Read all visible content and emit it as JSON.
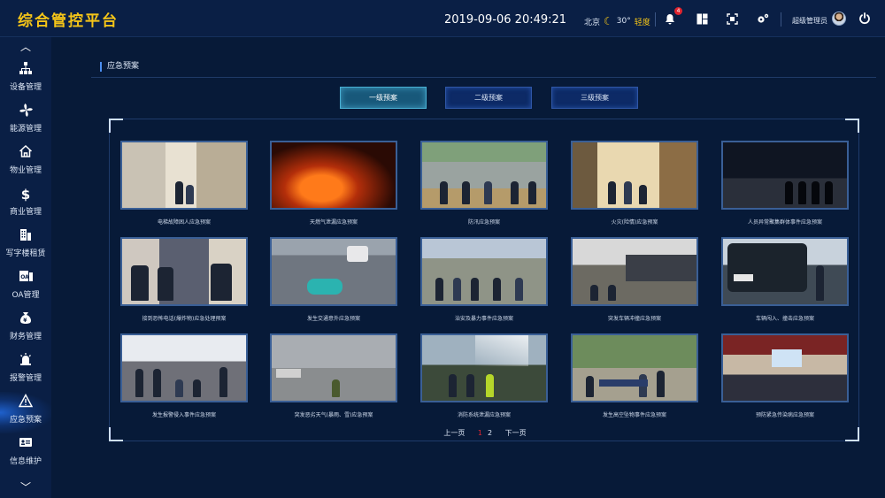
{
  "app": {
    "title": "综合管控平台"
  },
  "header": {
    "datetime": "2019-09-06 20:49:21",
    "weather": {
      "city": "北京",
      "temp": "30°",
      "quality": "轻度"
    },
    "alert_count": "4",
    "user_name": "超级管理员",
    "icons": [
      "bell-icon",
      "layout-icon",
      "fullscreen-icon",
      "settings-icon",
      "power-icon"
    ]
  },
  "sidebar": {
    "items": [
      {
        "label": "设备管理",
        "icon": "org-chart-icon"
      },
      {
        "label": "能源管理",
        "icon": "fan-icon"
      },
      {
        "label": "物业管理",
        "icon": "home-icon"
      },
      {
        "label": "商业管理",
        "icon": "yuan-icon"
      },
      {
        "label": "写字楼租赁",
        "icon": "building-icon"
      },
      {
        "label": "OA管理",
        "icon": "oa-icon"
      },
      {
        "label": "财务管理",
        "icon": "money-bag-icon"
      },
      {
        "label": "报警管理",
        "icon": "alarm-icon"
      },
      {
        "label": "应急预案",
        "icon": "warning-icon"
      },
      {
        "label": "信息维护",
        "icon": "info-card-icon"
      }
    ],
    "active_index": 8
  },
  "main": {
    "title": "应急预案",
    "tabs": [
      "一级预案",
      "二级预案",
      "三级预案"
    ],
    "active_tab": 0,
    "cards": [
      "电梯故障困人应急预案",
      "天燃气泄漏应急预案",
      "防汛应急预案",
      "火灾(险情)应急预案",
      "人员异常聚集群体事件应急预案",
      "接到恐怖电话(爆炸物)应急处理预案",
      "发生交通意外应急预案",
      "治安及暴力事件应急预案",
      "突发车辆冲撞应急预案",
      "车辆闯入、撞击应急预案",
      "发生报警侵入事件应急预案",
      "突发恶劣天气(暴雨、雪)应急预案",
      "消防系统泄漏应急预案",
      "发生高空坠物事件应急预案",
      "预防紧急传染病应急预案"
    ],
    "pager": {
      "prev": "上一页",
      "pages": [
        "1",
        "2"
      ],
      "current": "1",
      "next": "下一页"
    }
  }
}
